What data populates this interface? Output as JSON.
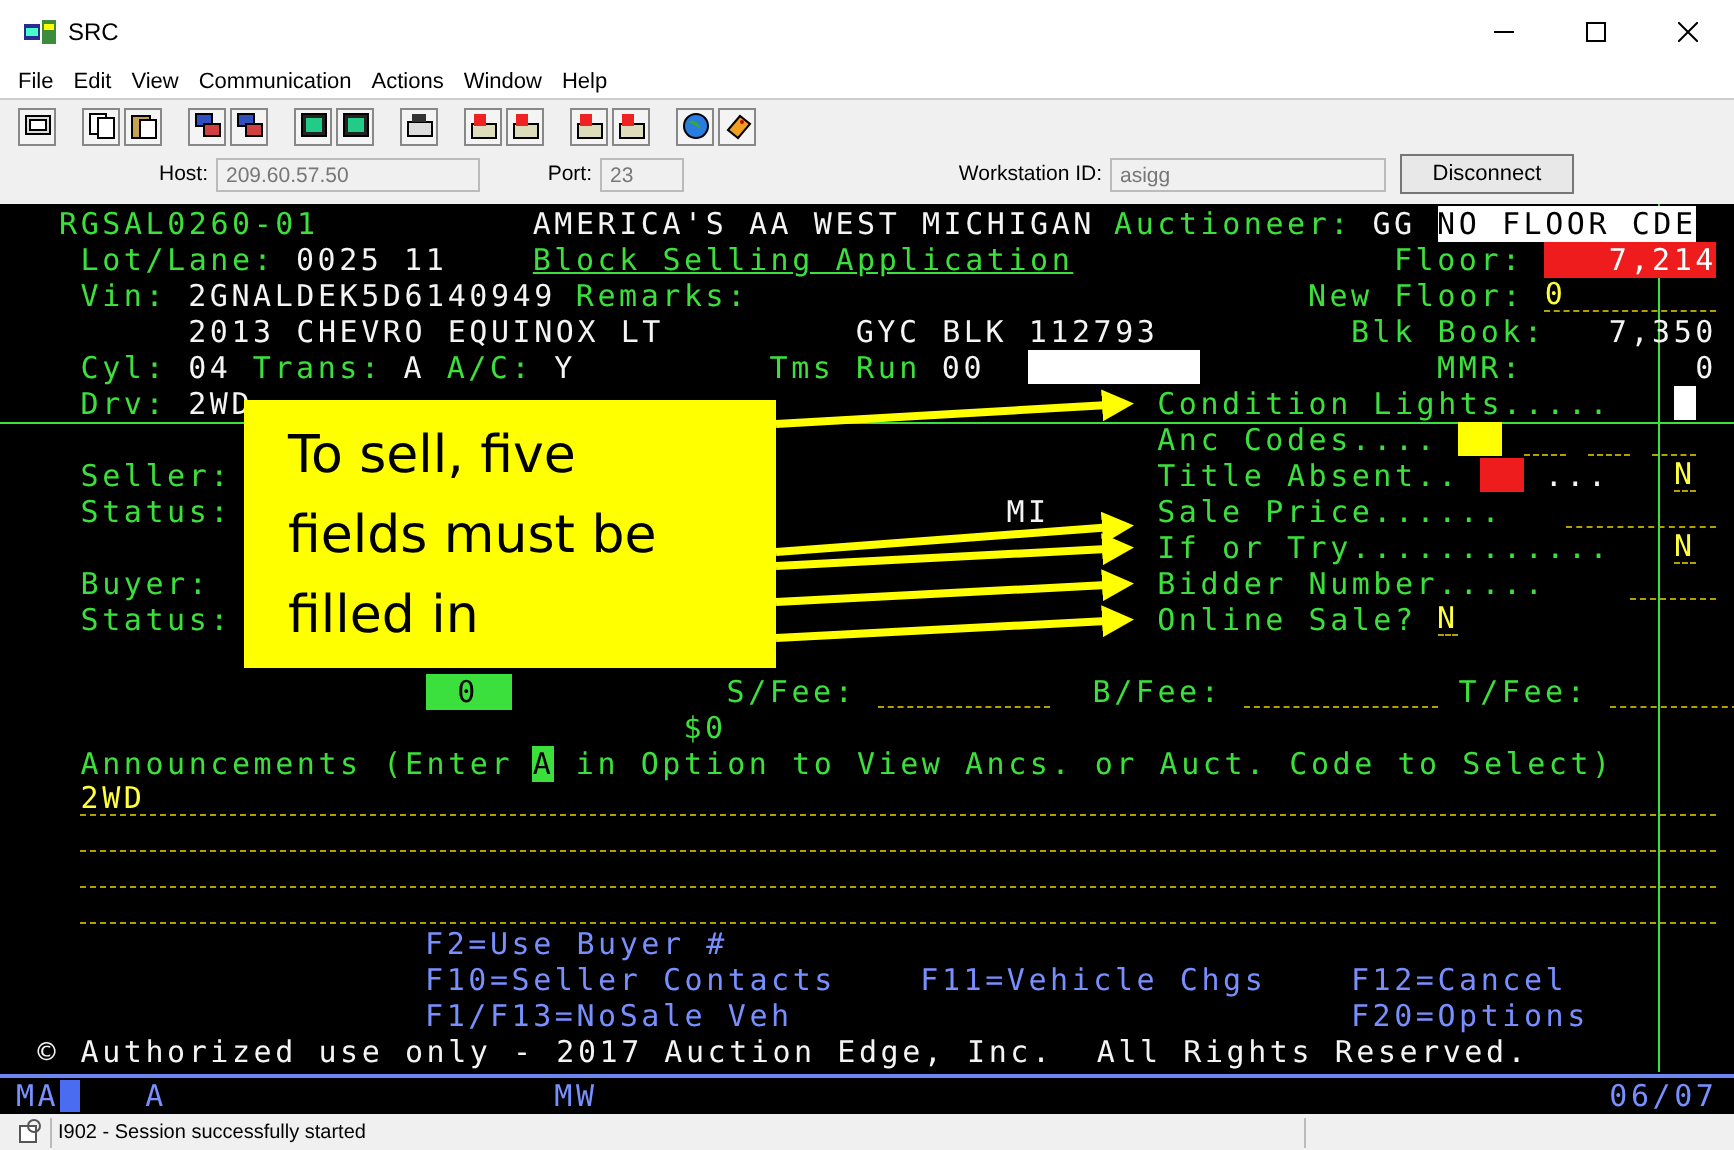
{
  "window": {
    "title": "SRC"
  },
  "menu": [
    "File",
    "Edit",
    "View",
    "Communication",
    "Actions",
    "Window",
    "Help"
  ],
  "connection": {
    "host_label": "Host:",
    "host": "209.60.57.50",
    "port_label": "Port:",
    "port": "23",
    "workstation_label": "Workstation ID:",
    "workstation": "asigg",
    "disconnect": "Disconnect"
  },
  "terminal": {
    "rows": [
      {
        "parts": [
          {
            "kind": "label",
            "text": "RGSAL0260-01"
          },
          {
            "kind": "value",
            "text": "AMERICA'S AA WEST MICHIGAN"
          },
          {
            "kind": "label",
            "text": "Auctioneer:"
          },
          {
            "kind": "value",
            "text": "GG"
          },
          {
            "kind": "highlight",
            "text": "NO FLOOR CDE"
          }
        ]
      },
      {
        "parts": [
          {
            "kind": "label",
            "text": "Lot/Lane:"
          },
          {
            "kind": "value",
            "text": "0025 11"
          },
          {
            "kind": "link",
            "text": "Block Selling Application"
          },
          {
            "kind": "label",
            "text": "Floor:"
          },
          {
            "kind": "alert",
            "text": "7,214"
          }
        ]
      },
      {
        "parts": [
          {
            "kind": "label",
            "text": "Vin:"
          },
          {
            "kind": "value",
            "text": "2GNALDEK5D6140949"
          },
          {
            "kind": "label",
            "text": "Remarks:"
          },
          {
            "kind": "label",
            "text": "New Floor:"
          },
          {
            "kind": "field",
            "text": "0"
          }
        ]
      },
      {
        "parts": [
          {
            "kind": "value",
            "text": "2013 CHEVRO EQUINOX LT"
          },
          {
            "kind": "value",
            "text": "GYC BLK 112793"
          },
          {
            "kind": "label",
            "text": "Blk Book:"
          },
          {
            "kind": "value",
            "text": "7,350"
          }
        ]
      },
      {
        "parts": [
          {
            "kind": "label",
            "text": "Cyl:"
          },
          {
            "kind": "value",
            "text": "04"
          },
          {
            "kind": "label",
            "text": "Trans:"
          },
          {
            "kind": "value",
            "text": "A"
          },
          {
            "kind": "label",
            "text": "A/C:"
          },
          {
            "kind": "value",
            "text": "Y"
          },
          {
            "kind": "label",
            "text": "Tms Run"
          },
          {
            "kind": "value",
            "text": "00"
          },
          {
            "kind": "block",
            "color": "#ffffff"
          },
          {
            "kind": "label",
            "text": "MMR:"
          },
          {
            "kind": "value",
            "text": "0"
          }
        ]
      },
      {
        "parts": [
          {
            "kind": "label",
            "text": "Drv:"
          },
          {
            "kind": "value",
            "text": "2WD"
          },
          {
            "kind": "label",
            "text": "Condition Lights....."
          },
          {
            "kind": "block",
            "color": "#ffffff"
          }
        ]
      },
      {
        "parts": [
          {
            "kind": "label",
            "text": "Anc Codes...."
          },
          {
            "kind": "block",
            "color": "#ffff00"
          },
          {
            "kind": "field"
          },
          {
            "kind": "field"
          },
          {
            "kind": "field"
          }
        ]
      },
      {
        "parts": [
          {
            "kind": "label",
            "text": "Seller:"
          },
          {
            "kind": "label",
            "text": "Title Absent.."
          },
          {
            "kind": "block",
            "color": "#ee1c1c"
          },
          {
            "kind": "value",
            "text": "..."
          },
          {
            "kind": "field",
            "text": "N"
          }
        ]
      },
      {
        "parts": [
          {
            "kind": "label",
            "text": "Status:"
          },
          {
            "kind": "value",
            "text": "MI"
          },
          {
            "kind": "label",
            "text": "Sale Price......"
          },
          {
            "kind": "field"
          }
        ]
      },
      {
        "parts": [
          {
            "kind": "label",
            "text": "If or Try............"
          },
          {
            "kind": "field",
            "text": "N"
          }
        ]
      },
      {
        "parts": [
          {
            "kind": "label",
            "text": "Buyer:"
          },
          {
            "kind": "label",
            "text": "Bidder Number....."
          },
          {
            "kind": "field"
          }
        ]
      },
      {
        "parts": [
          {
            "kind": "label",
            "text": "Status:"
          },
          {
            "kind": "label",
            "text": "Online Sale?"
          },
          {
            "kind": "field",
            "text": "N"
          }
        ]
      },
      {
        "parts": [
          {
            "kind": "reverse",
            "text": "0"
          },
          {
            "kind": "label",
            "text": "S/Fee:"
          },
          {
            "kind": "field"
          },
          {
            "kind": "label",
            "text": "B/Fee:"
          },
          {
            "kind": "field"
          },
          {
            "kind": "label",
            "text": "T/Fee:"
          },
          {
            "kind": "field"
          }
        ]
      },
      {
        "parts": [
          {
            "kind": "label",
            "text": "$0"
          }
        ]
      },
      {
        "parts": [
          {
            "kind": "label",
            "text": "Announcements (Enter"
          },
          {
            "kind": "reverse",
            "text": "A"
          },
          {
            "kind": "label",
            "text": "in Option to View Ancs. or Auct. Code to Select)"
          }
        ]
      },
      {
        "parts": [
          {
            "kind": "field",
            "text": "2WD"
          }
        ]
      },
      {
        "parts": [
          {
            "kind": "field"
          }
        ]
      },
      {
        "parts": [
          {
            "kind": "field"
          }
        ]
      },
      {
        "parts": [
          {
            "kind": "field"
          }
        ]
      },
      {
        "parts": [
          {
            "kind": "key",
            "text": "F2=Use Buyer #"
          }
        ]
      },
      {
        "parts": [
          {
            "kind": "key",
            "text": "F10=Seller Contacts"
          },
          {
            "kind": "key",
            "text": "F11=Vehicle Chgs"
          },
          {
            "kind": "key",
            "text": "F12=Cancel"
          }
        ]
      },
      {
        "parts": [
          {
            "kind": "key",
            "text": "F1/F13=NoSale Veh"
          },
          {
            "kind": "key",
            "text": "F20=Options"
          }
        ]
      },
      {
        "parts": [
          {
            "kind": "value",
            "text": "©"
          },
          {
            "kind": "value",
            "text": "Authorized use only - 2017 Auction Edge, Inc.  All Rights Reserved."
          }
        ]
      }
    ],
    "indicators": [
      "MA",
      "A",
      "MW",
      "06/07"
    ]
  },
  "callout": {
    "text": "To sell, five fields must be filled in"
  },
  "status_bar": {
    "message": "I902 - Session successfully started"
  }
}
